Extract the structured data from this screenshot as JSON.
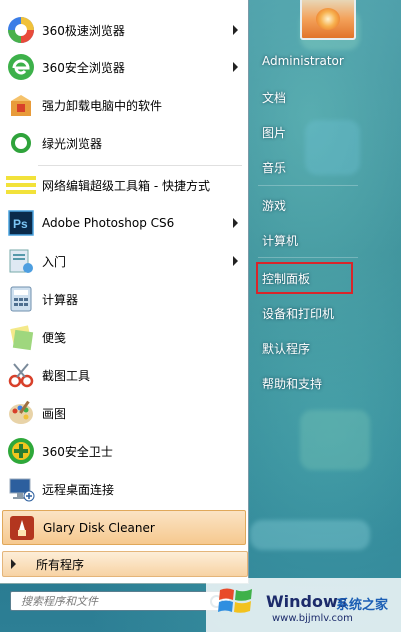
{
  "left_menu": {
    "items": [
      {
        "label": "360极速浏览器",
        "icon": "360-speed-browser-icon",
        "arrow": true
      },
      {
        "label": "360安全浏览器",
        "icon": "360-safe-browser-icon",
        "arrow": true
      },
      {
        "label": "强力卸载电脑中的软件",
        "icon": "uninstall-box-icon",
        "arrow": false
      },
      {
        "label": "绿光浏览器",
        "icon": "green-browser-icon",
        "arrow": false
      },
      {
        "label": "网络编辑超级工具箱 - 快捷方式",
        "icon": "toolbox-shortcut-icon",
        "arrow": false
      },
      {
        "label": "Adobe Photoshop CS6",
        "icon": "photoshop-icon",
        "arrow": true
      },
      {
        "label": "入门",
        "icon": "getting-started-icon",
        "arrow": true
      },
      {
        "label": "计算器",
        "icon": "calculator-icon",
        "arrow": false
      },
      {
        "label": "便笺",
        "icon": "sticky-notes-icon",
        "arrow": false
      },
      {
        "label": "截图工具",
        "icon": "snipping-tool-icon",
        "arrow": false
      },
      {
        "label": "画图",
        "icon": "paint-palette-icon",
        "arrow": false
      },
      {
        "label": "360安全卫士",
        "icon": "360-security-guard-icon",
        "arrow": false
      },
      {
        "label": "远程桌面连接",
        "icon": "remote-desktop-icon",
        "arrow": false
      },
      {
        "label": "Glary Disk Cleaner",
        "icon": "disk-cleaner-icon",
        "arrow": false
      }
    ],
    "all_programs": "所有程序",
    "search_placeholder": "搜索程序和文件"
  },
  "right_menu": {
    "user": "Administrator",
    "items": [
      "文档",
      "图片",
      "音乐",
      "游戏",
      "计算机",
      "控制面板",
      "设备和打印机",
      "默认程序",
      "帮助和支持"
    ],
    "highlighted": "控制面板"
  },
  "watermark": {
    "brand": "Windows",
    "site_cn": "系统之家",
    "url": "www.bjjmlv.com"
  },
  "colors": {
    "highlight": "#f6c98f",
    "red_box": "#d9252a",
    "glass": "#2a6e86"
  }
}
